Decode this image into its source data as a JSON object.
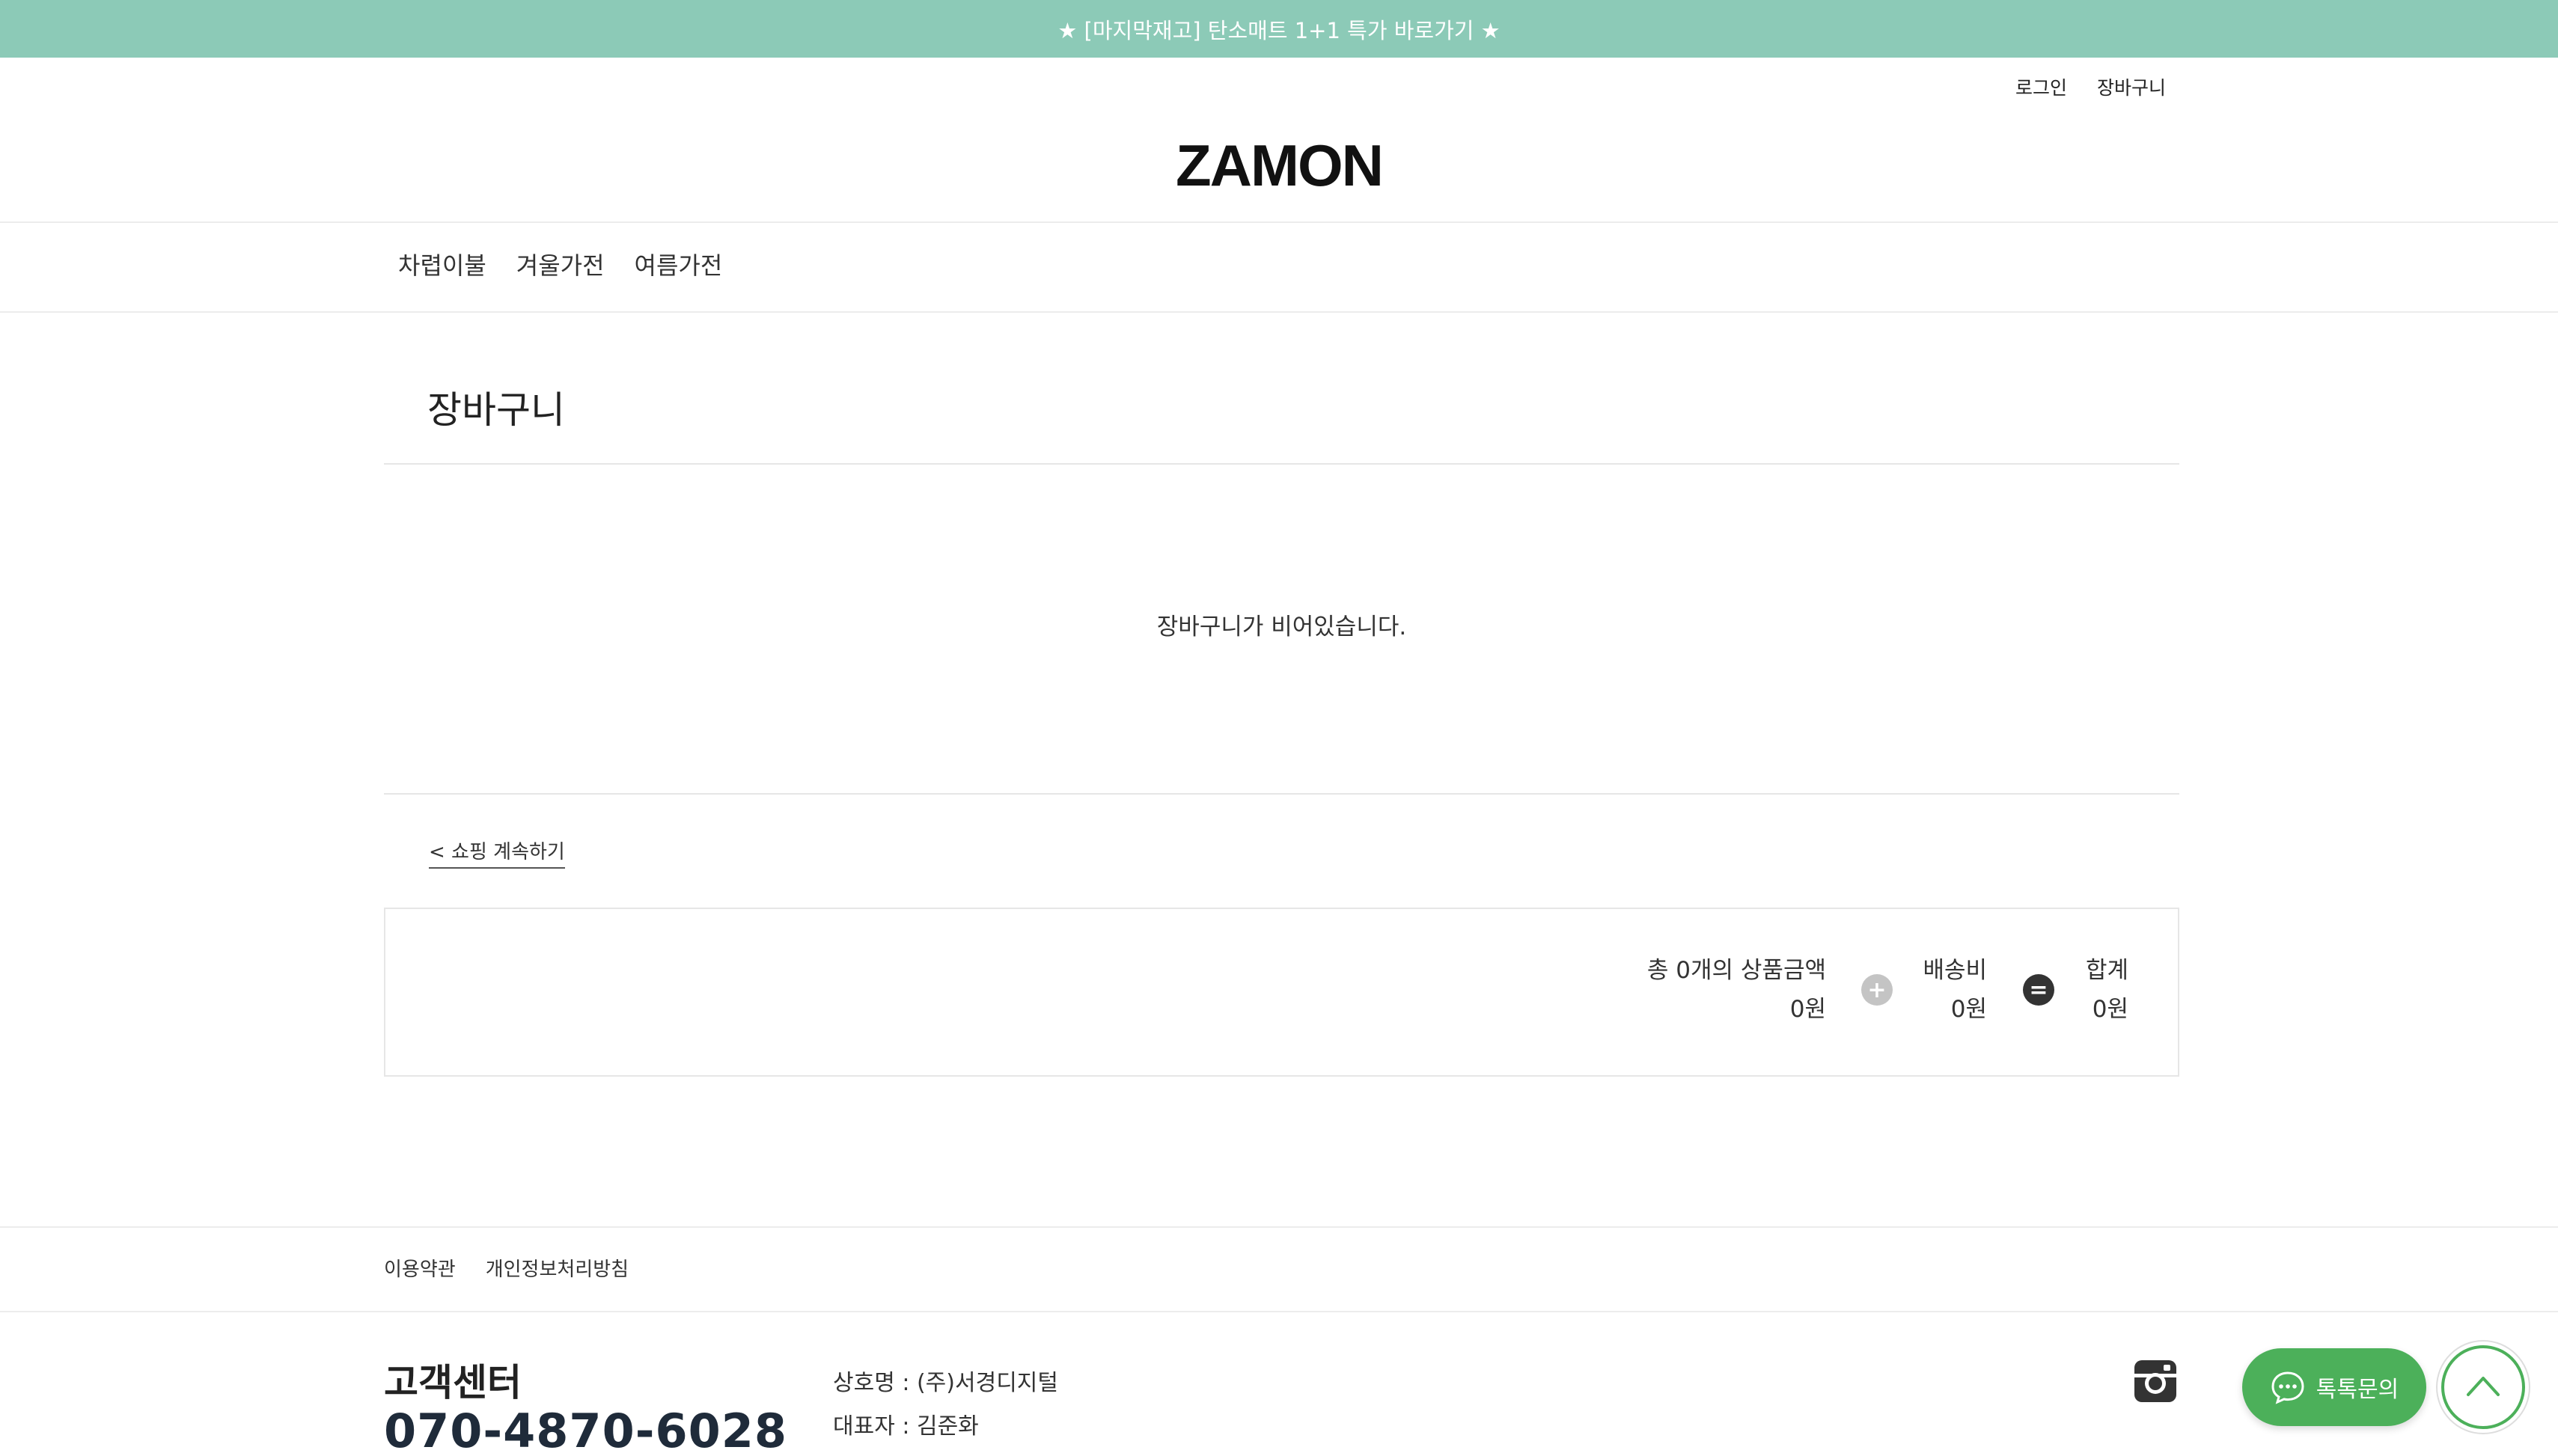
{
  "banner": {
    "text": "★ [마지막재고] 탄소매트 1+1 특가 바로가기 ★"
  },
  "util_nav": {
    "login": "로그인",
    "cart": "장바구니"
  },
  "logo": {
    "text": "ZAMON"
  },
  "gnb": {
    "items": [
      "차렵이불",
      "겨울가전",
      "여름가전"
    ]
  },
  "page": {
    "title": "장바구니",
    "empty_message": "장바구니가 비어있습니다.",
    "continue_shopping": "< 쇼핑 계속하기"
  },
  "summary": {
    "products_label": "총 0개의 상품금액",
    "products_value": "0원",
    "plus_symbol": "+",
    "shipping_label": "배송비",
    "shipping_value": "0원",
    "equals_symbol": "=",
    "total_label": "합계",
    "total_value": "0원"
  },
  "footer": {
    "links": [
      "이용약관",
      "개인정보처리방침"
    ],
    "cs_title": "고객센터",
    "cs_phone": "070-4870-6028",
    "company_name": "상호명 : (주)서경디지털",
    "ceo": "대표자 : 김준화"
  },
  "floating": {
    "talk_label": "톡톡문의"
  },
  "colors": {
    "banner_bg": "#8ccab7",
    "talk_green": "#4cb05a",
    "plus_circle": "#c4c4c4",
    "equals_circle": "#333333"
  },
  "icons": {
    "instagram": "instagram-icon",
    "talk": "chat-bubble-icon",
    "top": "chevron-up-icon"
  }
}
